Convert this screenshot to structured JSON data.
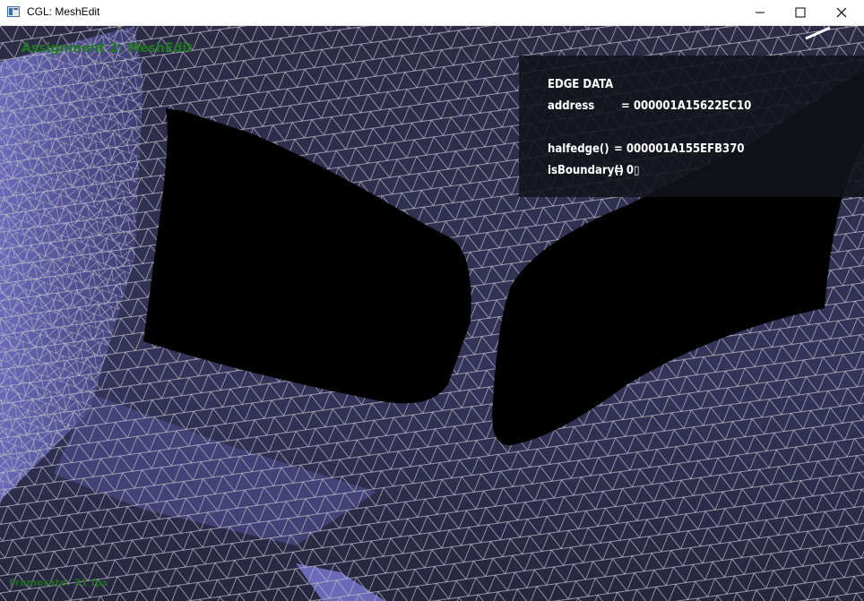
{
  "window": {
    "title": "CGL: MeshEdit",
    "icon": "app-window-icon",
    "controls": [
      "minimize-icon",
      "maximize-icon",
      "close-icon"
    ]
  },
  "hud": {
    "title": "Assignment 2: MeshEdit",
    "framerate": "Framerate: 31 fps"
  },
  "edge_data": {
    "heading": "EDGE DATA",
    "address_label": "address",
    "address_value": "= 000001A15622EC10",
    "halfedge_label": "halfedge()",
    "halfedge_value": "= 000001A155EFB370",
    "boundary_label": "isBoundary()",
    "boundary_value": "= 0▯"
  },
  "colors": {
    "mesh_face": "#2a2a44",
    "mesh_face_lit": "#5a5aa0",
    "mesh_wire": "#b9b9c6",
    "hole": "#000000",
    "hud_green": "#1f7a1f",
    "panel_bg": "#12121a"
  }
}
